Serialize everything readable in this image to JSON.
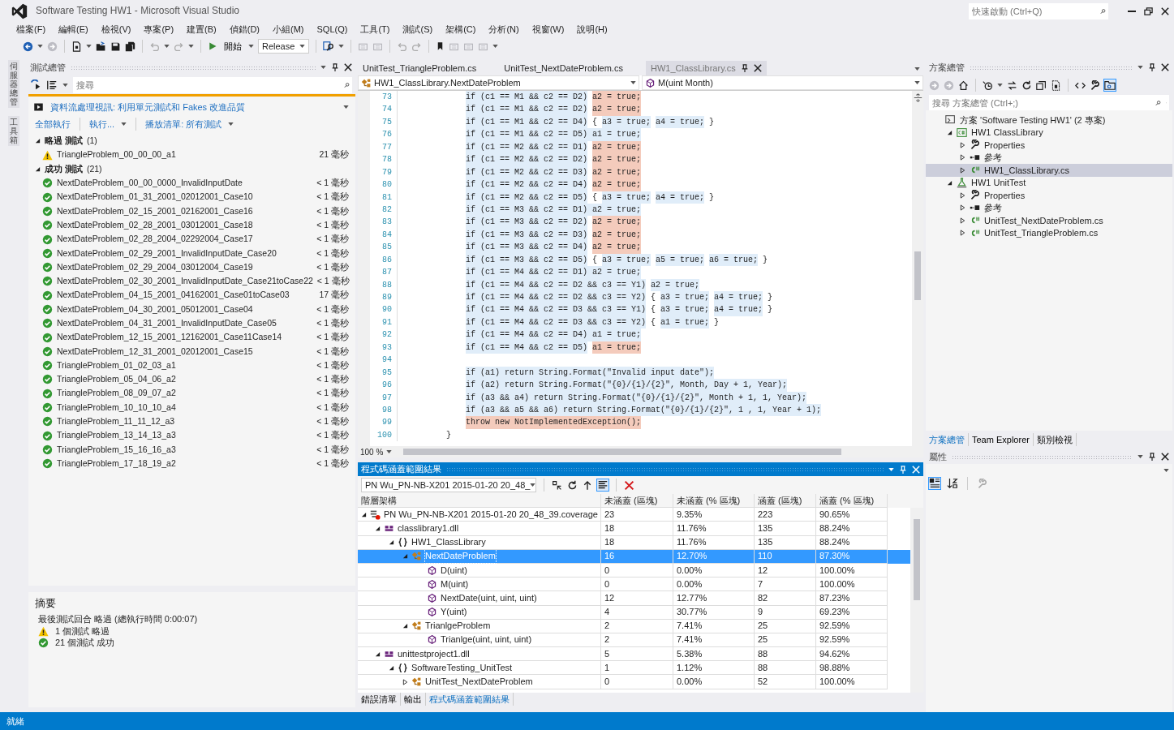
{
  "window": {
    "title": "Software Testing HW1 - Microsoft Visual Studio",
    "quick_launch": {
      "placeholder": "快速啟動 (Ctrl+Q)"
    }
  },
  "menu": [
    "檔案(F)",
    "編輯(E)",
    "檢視(V)",
    "專案(P)",
    "建置(B)",
    "偵錯(D)",
    "小組(M)",
    "SQL(Q)",
    "工具(T)",
    "測試(S)",
    "架構(C)",
    "分析(N)",
    "視窗(W)",
    "說明(H)"
  ],
  "toolbar": {
    "start_button": "開始",
    "configuration": "Release"
  },
  "side_tabs": [
    "伺服器總管",
    "工具箱"
  ],
  "test_explorer": {
    "title": "測試總管",
    "search": {
      "placeholder": "搜尋"
    },
    "banner": "資料流處理視訊: 利用單元測試和 Fakes 改進品質",
    "actions": [
      {
        "label": "全部執行",
        "dropdown": false
      },
      {
        "label": "執行...",
        "dropdown": true
      },
      {
        "label": "播放清單: 所有測試",
        "dropdown": true
      }
    ],
    "groups": [
      {
        "label": "略過 測試",
        "count": "(1)",
        "expanded": true,
        "tests": [
          {
            "name": "TriangleProblem_00_00_00_a1",
            "kind": "skipped",
            "duration": "21 毫秒"
          }
        ]
      },
      {
        "label": "成功 測試",
        "count": "(21)",
        "expanded": true,
        "tests": [
          {
            "name": "NextDateProblem_00_00_0000_InvalidInputDate",
            "kind": "passed",
            "duration": "< 1 毫秒"
          },
          {
            "name": "NextDateProblem_01_31_2001_02012001_Case10",
            "kind": "passed",
            "duration": "< 1 毫秒"
          },
          {
            "name": "NextDateProblem_02_15_2001_02162001_Case16",
            "kind": "passed",
            "duration": "< 1 毫秒"
          },
          {
            "name": "NextDateProblem_02_28_2001_03012001_Case18",
            "kind": "passed",
            "duration": "< 1 毫秒"
          },
          {
            "name": "NextDateProblem_02_28_2004_02292004_Case17",
            "kind": "passed",
            "duration": "< 1 毫秒"
          },
          {
            "name": "NextDateProblem_02_29_2001_InvalidInputDate_Case20",
            "kind": "passed",
            "duration": "< 1 毫秒"
          },
          {
            "name": "NextDateProblem_02_29_2004_03012004_Case19",
            "kind": "passed",
            "duration": "< 1 毫秒"
          },
          {
            "name": "NextDateProblem_02_30_2001_InvalidInputDate_Case21toCase22",
            "kind": "passed",
            "duration": "< 1 毫秒"
          },
          {
            "name": "NextDateProblem_04_15_2001_04162001_Case01toCase03",
            "kind": "passed",
            "duration": "17 毫秒"
          },
          {
            "name": "NextDateProblem_04_30_2001_05012001_Case04",
            "kind": "passed",
            "duration": "< 1 毫秒"
          },
          {
            "name": "NextDateProblem_04_31_2001_InvalidInputDate_Case05",
            "kind": "passed",
            "duration": "< 1 毫秒"
          },
          {
            "name": "NextDateProblem_12_15_2001_12162001_Case11Case14",
            "kind": "passed",
            "duration": "< 1 毫秒"
          },
          {
            "name": "NextDateProblem_12_31_2001_02012001_Case15",
            "kind": "passed",
            "duration": "< 1 毫秒"
          },
          {
            "name": "TriangleProblem_01_02_03_a1",
            "kind": "passed",
            "duration": "< 1 毫秒"
          },
          {
            "name": "TriangleProblem_05_04_06_a2",
            "kind": "passed",
            "duration": "< 1 毫秒"
          },
          {
            "name": "TriangleProblem_08_09_07_a2",
            "kind": "passed",
            "duration": "< 1 毫秒"
          },
          {
            "name": "TriangleProblem_10_10_10_a4",
            "kind": "passed",
            "duration": "< 1 毫秒"
          },
          {
            "name": "TriangleProblem_11_11_12_a3",
            "kind": "passed",
            "duration": "< 1 毫秒"
          },
          {
            "name": "TriangleProblem_13_14_13_a3",
            "kind": "passed",
            "duration": "< 1 毫秒"
          },
          {
            "name": "TriangleProblem_15_16_16_a3",
            "kind": "passed",
            "duration": "< 1 毫秒"
          },
          {
            "name": "TriangleProblem_17_18_19_a2",
            "kind": "passed",
            "duration": "< 1 毫秒"
          }
        ]
      }
    ],
    "summary": {
      "title": "摘要",
      "last_run": "最後測試回合 略過 (總執行時間 0:00:07)",
      "results": [
        {
          "kind": "skipped",
          "text": "1 個測試 略過"
        },
        {
          "kind": "passed",
          "text": "21 個測試 成功"
        }
      ]
    }
  },
  "editor": {
    "tabs": [
      {
        "label": "UnitTest_TriangleProblem.cs",
        "selected": false
      },
      {
        "label": "UnitTest_NextDateProblem.cs",
        "selected": false
      },
      {
        "label": "HW1_ClassLibrary.cs",
        "selected": true
      }
    ],
    "type_dropdown": "HW1_ClassLibrary.NextDateProblem",
    "member_dropdown": "M(uint Month)",
    "zoom": "100 %",
    "lines": [
      {
        "number": "73",
        "kind": "statement",
        "segments": [
          {
            "text": "if (c1 == M1 && c2 == D2)",
            "kind": "covered"
          },
          {
            "text": "a2 = true;",
            "kind": "uncovered"
          }
        ]
      },
      {
        "number": "74",
        "kind": "statement",
        "segments": [
          {
            "text": "if (c1 == M1 && c2 == D2)",
            "kind": "covered"
          },
          {
            "text": "a2 = true;",
            "kind": "uncovered"
          }
        ]
      },
      {
        "number": "75",
        "kind": "statement",
        "segments": [
          {
            "text": "if (c1 == M1 && c2 == D4)",
            "kind": "covered"
          },
          {
            "text": "{",
            "kind": "plain"
          },
          {
            "text": "a3 = true;",
            "kind": "covered"
          },
          {
            "text": "a4 = true;",
            "kind": "covered"
          },
          {
            "text": "}",
            "kind": "plain"
          }
        ]
      },
      {
        "number": "76",
        "kind": "statement",
        "segments": [
          {
            "text": "if (c1 == M1 && c2 == D5) a1 = true;",
            "kind": "covered"
          }
        ]
      },
      {
        "number": "77",
        "kind": "statement",
        "segments": [
          {
            "text": "if (c1 == M2 && c2 == D1)",
            "kind": "covered"
          },
          {
            "text": "a2 = true;",
            "kind": "uncovered"
          }
        ]
      },
      {
        "number": "78",
        "kind": "statement",
        "segments": [
          {
            "text": "if (c1 == M2 && c2 == D2)",
            "kind": "covered"
          },
          {
            "text": "a2 = true;",
            "kind": "uncovered"
          }
        ]
      },
      {
        "number": "79",
        "kind": "statement",
        "segments": [
          {
            "text": "if (c1 == M2 && c2 == D3)",
            "kind": "covered"
          },
          {
            "text": "a2 = true;",
            "kind": "uncovered"
          }
        ]
      },
      {
        "number": "80",
        "kind": "statement",
        "segments": [
          {
            "text": "if (c1 == M2 && c2 == D4)",
            "kind": "covered"
          },
          {
            "text": "a2 = true;",
            "kind": "uncovered"
          }
        ]
      },
      {
        "number": "81",
        "kind": "statement",
        "segments": [
          {
            "text": "if (c1 == M2 && c2 == D5)",
            "kind": "covered"
          },
          {
            "text": "{",
            "kind": "plain"
          },
          {
            "text": "a3 = true;",
            "kind": "covered"
          },
          {
            "text": "a4 = true;",
            "kind": "covered"
          },
          {
            "text": "}",
            "kind": "plain"
          }
        ]
      },
      {
        "number": "82",
        "kind": "statement",
        "segments": [
          {
            "text": "if (c1 == M3 && c2 == D1) a2 = true;",
            "kind": "covered"
          }
        ]
      },
      {
        "number": "83",
        "kind": "statement",
        "segments": [
          {
            "text": "if (c1 == M3 && c2 == D2)",
            "kind": "covered"
          },
          {
            "text": "a2 = true;",
            "kind": "uncovered"
          }
        ]
      },
      {
        "number": "84",
        "kind": "statement",
        "segments": [
          {
            "text": "if (c1 == M3 && c2 == D3)",
            "kind": "covered"
          },
          {
            "text": "a2 = true;",
            "kind": "uncovered"
          }
        ]
      },
      {
        "number": "85",
        "kind": "statement",
        "segments": [
          {
            "text": "if (c1 == M3 && c2 == D4)",
            "kind": "covered"
          },
          {
            "text": "a2 = true;",
            "kind": "uncovered"
          }
        ]
      },
      {
        "number": "86",
        "kind": "statement",
        "segments": [
          {
            "text": "if (c1 == M3 && c2 == D5)",
            "kind": "covered"
          },
          {
            "text": "{",
            "kind": "plain"
          },
          {
            "text": "a3 = true;",
            "kind": "covered"
          },
          {
            "text": "a5 = true;",
            "kind": "covered"
          },
          {
            "text": "a6 = true;",
            "kind": "covered"
          },
          {
            "text": "}",
            "kind": "plain"
          }
        ]
      },
      {
        "number": "87",
        "kind": "statement",
        "segments": [
          {
            "text": "if (c1 == M4 && c2 == D1) a2 = true;",
            "kind": "covered"
          }
        ]
      },
      {
        "number": "88",
        "kind": "statement",
        "segments": [
          {
            "text": "if (c1 == M4 && c2 == D2 && c3 == Y1)",
            "kind": "covered"
          },
          {
            "text": "a2 = true;",
            "kind": "covered"
          }
        ]
      },
      {
        "number": "89",
        "kind": "statement",
        "segments": [
          {
            "text": "if (c1 == M4 && c2 == D2 && c3 == Y2)",
            "kind": "covered"
          },
          {
            "text": "{",
            "kind": "plain"
          },
          {
            "text": "a3 = true;",
            "kind": "covered"
          },
          {
            "text": "a4 = true;",
            "kind": "covered"
          },
          {
            "text": "}",
            "kind": "plain"
          }
        ]
      },
      {
        "number": "90",
        "kind": "statement",
        "segments": [
          {
            "text": "if (c1 == M4 && c2 == D3 && c3 == Y1)",
            "kind": "covered"
          },
          {
            "text": "{",
            "kind": "plain"
          },
          {
            "text": "a3 = true;",
            "kind": "covered"
          },
          {
            "text": "a4 = true;",
            "kind": "covered"
          },
          {
            "text": "}",
            "kind": "plain"
          }
        ]
      },
      {
        "number": "91",
        "kind": "statement",
        "segments": [
          {
            "text": "if (c1 == M4 && c2 == D3 && c3 == Y2)",
            "kind": "covered"
          },
          {
            "text": "{",
            "kind": "plain"
          },
          {
            "text": "a1 = true;",
            "kind": "covered"
          },
          {
            "text": "}",
            "kind": "plain"
          }
        ]
      },
      {
        "number": "92",
        "kind": "statement",
        "segments": [
          {
            "text": "if (c1 == M4 && c2 == D4) a1 = true;",
            "kind": "covered"
          }
        ]
      },
      {
        "number": "93",
        "kind": "statement",
        "segments": [
          {
            "text": "if (c1 == M4 && c2 == D5)",
            "kind": "covered"
          },
          {
            "text": "a1 = true;",
            "kind": "uncovered"
          }
        ]
      },
      {
        "number": "94"
      },
      {
        "number": "95",
        "kind": "statement",
        "segments": [
          {
            "text": "if (a1) return String.Format(\"Invalid input date\");",
            "kind": "covered"
          }
        ]
      },
      {
        "number": "96",
        "kind": "statement",
        "segments": [
          {
            "text": "if (a2) return String.Format(\"{0}/{1}/{2}\", Month, Day + 1, Year);",
            "kind": "covered"
          }
        ]
      },
      {
        "number": "97",
        "kind": "statement",
        "segments": [
          {
            "text": "if (a3 && a4) return String.Format(\"{0}/{1}/{2}\", Month + 1, 1, Year);",
            "kind": "covered"
          }
        ]
      },
      {
        "number": "98",
        "kind": "statement",
        "segments": [
          {
            "text": "if (a3 && a5 && a6) return String.Format(\"{0}/{1}/{2}\", 1 , 1, Year + 1);",
            "kind": "covered"
          }
        ]
      },
      {
        "number": "99",
        "kind": "statement",
        "segments": [
          {
            "text": "throw new NotImplementedException();",
            "kind": "uncovered"
          }
        ]
      },
      {
        "number": "100",
        "kind": "closing",
        "segments": [
          {
            "text": "}",
            "kind": "plain"
          }
        ]
      }
    ]
  },
  "coverage": {
    "title": "程式碼涵蓋範圍結果",
    "run_selector": "PN Wu_PN-NB-X201 2015-01-20 20_48_",
    "columns": [
      "階層架構",
      "未涵蓋 (區塊)",
      "未涵蓋 (% 區塊)",
      "涵蓋 (區塊)",
      "涵蓋 (% 區塊)"
    ],
    "rows": [
      {
        "kind": "coverage",
        "name": "PN Wu_PN-NB-X201 2015-01-20 20_48_39.coverage",
        "expanded": true,
        "selected": false,
        "values": [
          "23",
          "9.35%",
          "223",
          "90.65%"
        ],
        "children": [
          {
            "kind": "assembly",
            "name": "classlibrary1.dll",
            "expanded": true,
            "selected": false,
            "values": [
              "18",
              "11.76%",
              "135",
              "88.24%"
            ],
            "children": [
              {
                "kind": "namespace",
                "name": "HW1_ClassLibrary",
                "expanded": true,
                "selected": false,
                "values": [
                  "18",
                  "11.76%",
                  "135",
                  "88.24%"
                ],
                "children": [
                  {
                    "kind": "class",
                    "name": "NextDateProblem",
                    "expanded": true,
                    "selected": true,
                    "values": [
                      "16",
                      "12.70%",
                      "110",
                      "87.30%"
                    ],
                    "children": [
                      {
                        "kind": "method",
                        "name": "D(uint)",
                        "selected": false,
                        "values": [
                          "0",
                          "0.00%",
                          "12",
                          "100.00%"
                        ]
                      },
                      {
                        "kind": "method",
                        "name": "M(uint)",
                        "selected": false,
                        "values": [
                          "0",
                          "0.00%",
                          "7",
                          "100.00%"
                        ]
                      },
                      {
                        "kind": "method",
                        "name": "NextDate(uint, uint, uint)",
                        "selected": false,
                        "values": [
                          "12",
                          "12.77%",
                          "82",
                          "87.23%"
                        ]
                      },
                      {
                        "kind": "method",
                        "name": "Y(uint)",
                        "selected": false,
                        "values": [
                          "4",
                          "30.77%",
                          "9",
                          "69.23%"
                        ]
                      }
                    ]
                  },
                  {
                    "kind": "class",
                    "name": "TrianlgeProblem",
                    "expanded": true,
                    "selected": false,
                    "values": [
                      "2",
                      "7.41%",
                      "25",
                      "92.59%"
                    ],
                    "children": [
                      {
                        "kind": "method",
                        "name": "Trianlge(uint, uint, uint)",
                        "selected": false,
                        "values": [
                          "2",
                          "7.41%",
                          "25",
                          "92.59%"
                        ]
                      }
                    ]
                  }
                ]
              }
            ]
          },
          {
            "kind": "assembly",
            "name": "unittestproject1.dll",
            "expanded": true,
            "selected": false,
            "values": [
              "5",
              "5.38%",
              "88",
              "94.62%"
            ],
            "children": [
              {
                "kind": "namespace",
                "name": "SoftwareTesting_UnitTest",
                "expanded": true,
                "selected": false,
                "values": [
                  "1",
                  "1.12%",
                  "88",
                  "98.88%"
                ],
                "children": [
                  {
                    "kind": "class",
                    "name": "UnitTest_NextDateProblem",
                    "expanded": false,
                    "selected": false,
                    "values": [
                      "0",
                      "0.00%",
                      "52",
                      "100.00%"
                    ]
                  }
                ]
              }
            ]
          }
        ]
      }
    ]
  },
  "bottom_tabs": [
    {
      "label": "錯誤清單",
      "selected": false
    },
    {
      "label": "輸出",
      "selected": false
    },
    {
      "label": "程式碼涵蓋範圍結果",
      "selected": true
    }
  ],
  "solution_explorer": {
    "title": "方案總管",
    "search": {
      "placeholder": "搜尋 方案總管 (Ctrl+;)"
    },
    "tree": [
      {
        "kind": "solution",
        "label": "方案 'Software Testing HW1' (2 專案)",
        "selected": false,
        "children": [
          {
            "kind": "project",
            "label": "HW1 ClassLibrary",
            "expanded": true,
            "selected": false,
            "children": [
              {
                "kind": "properties",
                "label": "Properties",
                "expanded": false,
                "selected": false
              },
              {
                "kind": "references",
                "label": "參考",
                "expanded": false,
                "selected": false
              },
              {
                "kind": "csfile",
                "label": "HW1_ClassLibrary.cs",
                "expanded": false,
                "selected": true
              }
            ]
          },
          {
            "kind": "testproject",
            "label": "HW1 UnitTest",
            "expanded": true,
            "selected": false,
            "children": [
              {
                "kind": "properties",
                "label": "Properties",
                "expanded": false,
                "selected": false
              },
              {
                "kind": "references",
                "label": "參考",
                "expanded": false,
                "selected": false
              },
              {
                "kind": "csfile",
                "label": "UnitTest_NextDateProblem.cs",
                "expanded": false,
                "selected": false
              },
              {
                "kind": "csfile",
                "label": "UnitTest_TriangleProblem.cs",
                "expanded": false,
                "selected": false
              }
            ]
          }
        ]
      }
    ]
  },
  "right_tabs": [
    {
      "label": "方案總管",
      "selected": true
    },
    {
      "label": "Team Explorer",
      "selected": false
    },
    {
      "label": "類別檢視",
      "selected": false
    }
  ],
  "properties": {
    "title": "屬性"
  },
  "status_bar": {
    "text": "就緒"
  }
}
